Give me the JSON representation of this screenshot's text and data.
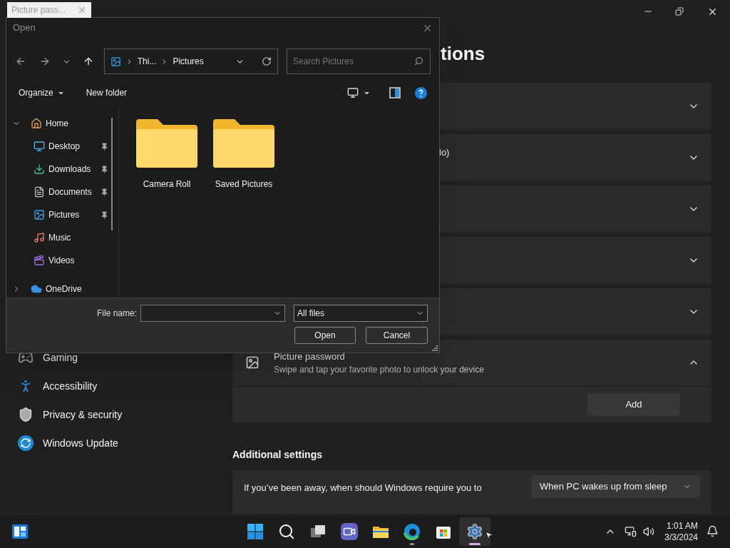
{
  "tab_thumbnail": {
    "title": "Picture pass..."
  },
  "settings": {
    "heading": "tions",
    "sidebar": [
      {
        "label": "Gaming",
        "kind": "gaming"
      },
      {
        "label": "Accessibility",
        "kind": "accessibility"
      },
      {
        "label": "Privacy & security",
        "kind": "privacy"
      },
      {
        "label": "Windows Update",
        "kind": "update"
      }
    ],
    "cards": [
      {
        "expanded": false
      },
      {
        "label": "lo)",
        "expanded": false
      },
      {
        "expanded": false
      },
      {
        "expanded": false
      },
      {
        "expanded": false
      }
    ],
    "picture_password": {
      "title": "Picture password",
      "description": "Swipe and tap your favorite photo to unlock your device",
      "expanded": true,
      "button": "Add"
    },
    "additional_settings": {
      "heading": "Additional settings",
      "question": "If you’ve been away, when should Windows require you to",
      "dropdown": "When PC wakes up from sleep"
    }
  },
  "dialog": {
    "title": "Open",
    "breadcrumb": [
      "Thi...",
      "Pictures"
    ],
    "search": {
      "placeholder": "Search Pictures"
    },
    "toolbar": {
      "organize": "Organize",
      "new_folder": "New folder"
    },
    "nav": [
      {
        "label": "Home",
        "kind": "home",
        "expanded": true,
        "children": [
          {
            "label": "Desktop",
            "kind": "desktop",
            "pinned": true
          },
          {
            "label": "Downloads",
            "kind": "downloads",
            "pinned": true
          },
          {
            "label": "Documents",
            "kind": "documents",
            "pinned": true
          },
          {
            "label": "Pictures",
            "kind": "pictures",
            "pinned": true
          },
          {
            "label": "Music",
            "kind": "music",
            "pinned": false
          },
          {
            "label": "Videos",
            "kind": "videos",
            "pinned": false
          }
        ]
      },
      {
        "label": "OneDrive",
        "kind": "onedrive",
        "expanded": false
      }
    ],
    "folders": [
      {
        "name": "Camera Roll"
      },
      {
        "name": "Saved Pictures"
      }
    ],
    "file_name_label": "File name:",
    "file_type": "All files",
    "buttons": [
      "Open",
      "Cancel"
    ]
  },
  "taskbar": {
    "apps": [
      {
        "kind": "start",
        "running": false,
        "active": false
      },
      {
        "kind": "search",
        "running": false,
        "active": false
      },
      {
        "kind": "taskview",
        "running": false,
        "active": false
      },
      {
        "kind": "chat",
        "running": false,
        "active": false
      },
      {
        "kind": "explorer",
        "running": false,
        "active": false
      },
      {
        "kind": "edge",
        "running": true,
        "active": false
      },
      {
        "kind": "store",
        "running": false,
        "active": false
      },
      {
        "kind": "settings",
        "running": true,
        "active": true
      }
    ],
    "time": "1:01 AM",
    "date": "3/3/2024"
  }
}
